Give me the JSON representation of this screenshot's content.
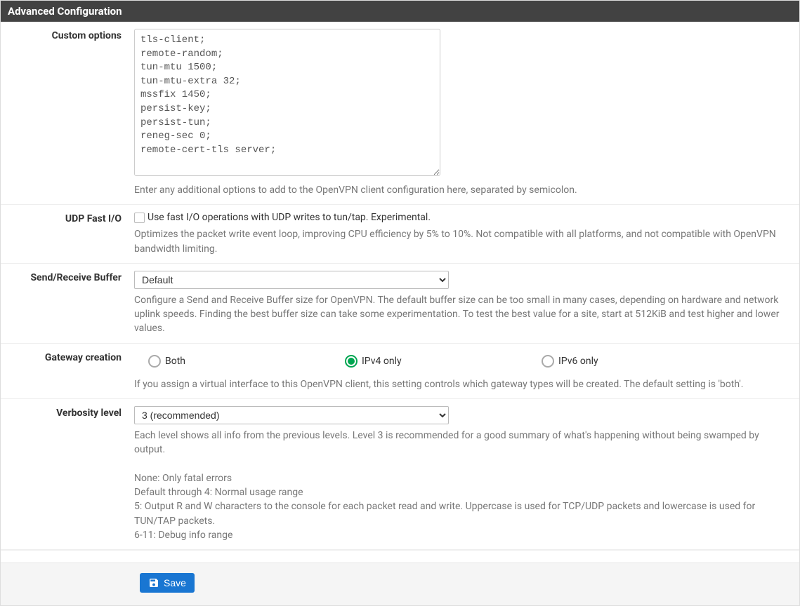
{
  "panel": {
    "title": "Advanced Configuration"
  },
  "custom_options": {
    "label": "Custom options",
    "value": "tls-client;\nremote-random;\ntun-mtu 1500;\ntun-mtu-extra 32;\nmssfix 1450;\npersist-key;\npersist-tun;\nreneg-sec 0;\nremote-cert-tls server;",
    "help": "Enter any additional options to add to the OpenVPN client configuration here, separated by semicolon."
  },
  "udp_fast_io": {
    "label": "UDP Fast I/O",
    "checkbox_label": "Use fast I/O operations with UDP writes to tun/tap. Experimental.",
    "checked": false,
    "help": "Optimizes the packet write event loop, improving CPU efficiency by 5% to 10%. Not compatible with all platforms, and not compatible with OpenVPN bandwidth limiting."
  },
  "send_receive_buffer": {
    "label": "Send/Receive Buffer",
    "selected": "Default",
    "help": "Configure a Send and Receive Buffer size for OpenVPN. The default buffer size can be too small in many cases, depending on hardware and network uplink speeds. Finding the best buffer size can take some experimentation. To test the best value for a site, start at 512KiB and test higher and lower values."
  },
  "gateway_creation": {
    "label": "Gateway creation",
    "options": {
      "both": "Both",
      "ipv4": "IPv4 only",
      "ipv6": "IPv6 only"
    },
    "selected": "ipv4",
    "help": "If you assign a virtual interface to this OpenVPN client, this setting controls which gateway types will be created. The default setting is 'both'."
  },
  "verbosity": {
    "label": "Verbosity level",
    "selected": "3 (recommended)",
    "help_main": "Each level shows all info from the previous levels. Level 3 is recommended for a good summary of what's happening without being swamped by output.",
    "help_lines": [
      "None: Only fatal errors",
      "Default through 4: Normal usage range",
      "5: Output R and W characters to the console for each packet read and write. Uppercase is used for TCP/UDP packets and lowercase is used for TUN/TAP packets.",
      "6-11: Debug info range"
    ]
  },
  "buttons": {
    "save": "Save"
  }
}
